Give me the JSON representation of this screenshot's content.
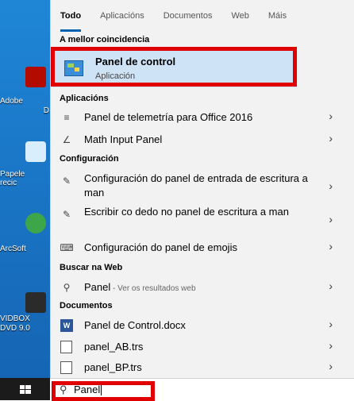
{
  "tabs": [
    "Todo",
    "Aplicacións",
    "Documentos",
    "Web",
    "Máis"
  ],
  "desktop_icons": [
    {
      "label1": "Adobe",
      "label2": "D"
    },
    {
      "label1": "Papele",
      "label2": "recic"
    },
    {
      "label1": "ArcSoft",
      "label2": ""
    },
    {
      "label1": "VIDBOX",
      "label2": "DVD 9.0"
    }
  ],
  "best_match": {
    "heading": "A mellor coincidencia",
    "title": "Panel de control",
    "subtitle": "Aplicación"
  },
  "apps": {
    "heading": "Aplicacións",
    "items": [
      "Panel de telemetría para Office 2016",
      "Math Input Panel"
    ]
  },
  "settings": {
    "heading": "Configuración",
    "items": [
      "Configuración do panel de entrada de escritura a man",
      "Escribir co dedo no panel de escritura a man",
      "Configuración do panel de emojis"
    ]
  },
  "web": {
    "heading": "Buscar na Web",
    "query": "Panel",
    "suffix": " - Ver os resultados web"
  },
  "documents": {
    "heading": "Documentos",
    "items": [
      "Panel de Control.docx",
      "panel_AB.trs",
      "panel_BP.trs"
    ]
  },
  "search": {
    "value": "Panel"
  },
  "colors": {
    "accent": "#0063b1",
    "highlight": "#e00000",
    "selection": "#cfe3f7"
  }
}
